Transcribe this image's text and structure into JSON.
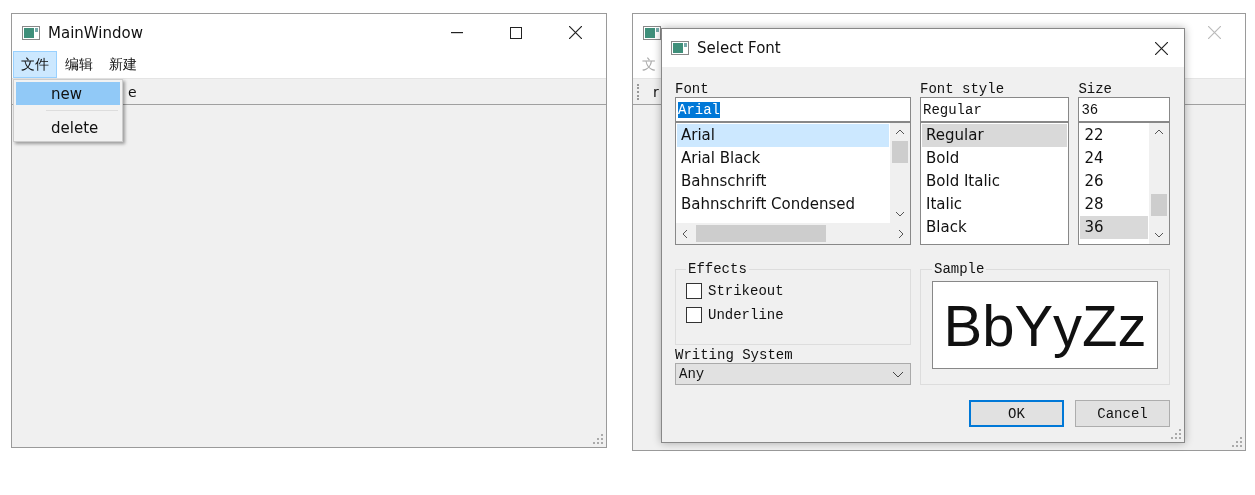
{
  "main_window": {
    "title": "MainWindow",
    "menu": [
      {
        "label": "文件",
        "selected": true
      },
      {
        "label": "编辑",
        "selected": false
      },
      {
        "label": "新建",
        "selected": false
      }
    ],
    "menu_popup": [
      {
        "label": "new",
        "selected": true
      },
      {
        "label": "delete",
        "selected": false
      }
    ],
    "toolbar_text": "e"
  },
  "second_window": {
    "menu_text": "文",
    "toolbar_text": "r",
    "dialog": {
      "title": "Select Font",
      "columns": [
        {
          "label": "Font",
          "value": "Arial",
          "value_selected": true,
          "items": [
            {
              "label": "Arial",
              "selected": true
            },
            {
              "label": "Arial Black",
              "selected": false
            },
            {
              "label": "Bahnschrift",
              "selected": false
            },
            {
              "label": "Bahnschrift Condensed",
              "selected": false
            }
          ]
        },
        {
          "label": "Font style",
          "value": "Regular",
          "value_selected": false,
          "items": [
            {
              "label": "Regular",
              "selected": true
            },
            {
              "label": "Bold",
              "selected": false
            },
            {
              "label": "Bold Italic",
              "selected": false
            },
            {
              "label": "Italic",
              "selected": false
            },
            {
              "label": "Black",
              "selected": false
            }
          ]
        },
        {
          "label": "Size",
          "value": "36",
          "value_selected": false,
          "items": [
            {
              "label": "22",
              "selected": false
            },
            {
              "label": "24",
              "selected": false
            },
            {
              "label": "26",
              "selected": false
            },
            {
              "label": "28",
              "selected": false
            },
            {
              "label": "36",
              "selected": true
            }
          ]
        }
      ],
      "effects": {
        "title": "Effects",
        "options": [
          {
            "label": "Strikeout",
            "checked": false
          },
          {
            "label": "Underline",
            "checked": false
          }
        ]
      },
      "writing_system": {
        "label": "Writing System",
        "value": "Any"
      },
      "sample": {
        "title": "Sample",
        "text": "BbYyZz"
      },
      "buttons": [
        {
          "label": "OK",
          "default": true
        },
        {
          "label": "Cancel",
          "default": false
        }
      ]
    }
  }
}
